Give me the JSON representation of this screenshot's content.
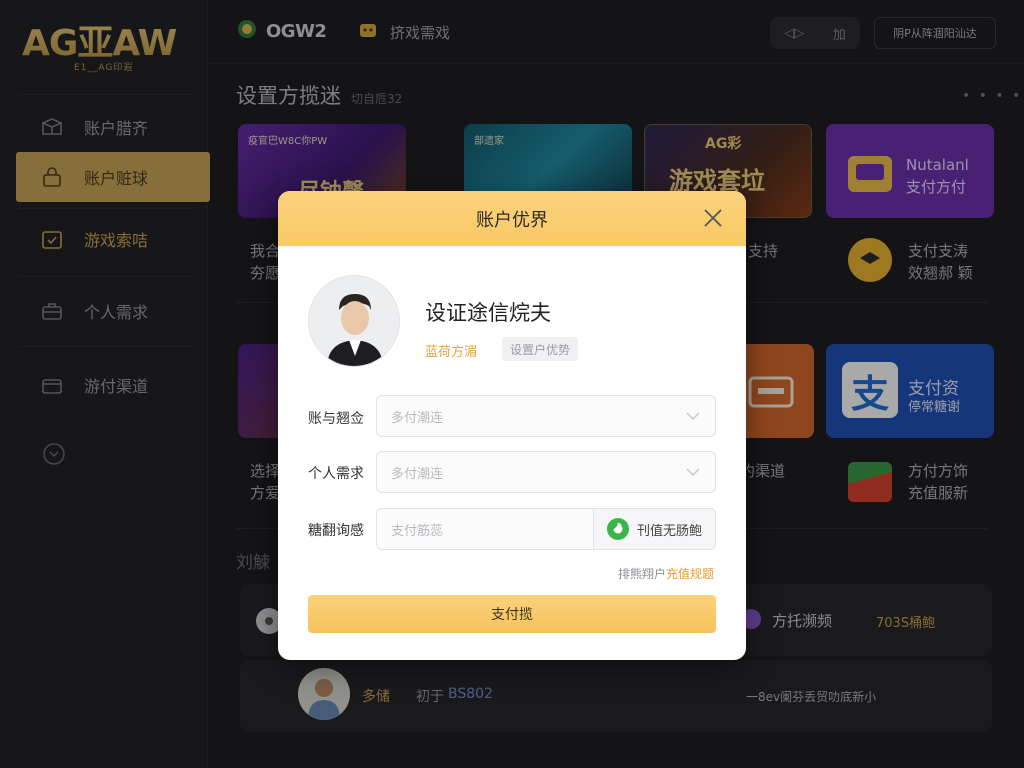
{
  "app": {
    "logo_main": "AG亚AW",
    "logo_sub": "E1__AG印遐"
  },
  "sidebar": {
    "items": [
      {
        "label": "账户腊齐",
        "icon": "box-icon"
      },
      {
        "label": "账户赃球",
        "icon": "lock-icon"
      },
      {
        "label": "游戏索咭",
        "icon": "calendar-check-icon"
      },
      {
        "label": "个人需求",
        "icon": "briefcase-icon"
      },
      {
        "label": "游付渠道",
        "icon": "wallet-icon"
      }
    ],
    "collapse_icon": "chevron-down-circle-icon"
  },
  "topbar": {
    "brand": "OGW2",
    "game": "挤戏需戏",
    "pill_left": "◁▷",
    "pill_right": "加",
    "account": "阴P从阵涸阳汕达"
  },
  "main": {
    "section_title": "设置方揽迷",
    "section_sub": "切自卮32",
    "dots": "• • • •",
    "tiles_row1": [
      {
        "label": "疫官巴W8C你PW",
        "big": "尽钠馨"
      },
      {
        "label": "部遗家",
        "big": ""
      },
      {
        "label": "AG彩",
        "big": "游戏套垃"
      },
      {
        "label": "",
        "title": "Nutalanl",
        "sub": "支付方付"
      }
    ],
    "promo_row1": [
      {
        "line1": "我合",
        "line2": "夯愿"
      },
      {
        "line1": "支持",
        "line2": ""
      },
      {
        "line1": "支付支涛",
        "line2": "效翘郝 颖"
      }
    ],
    "tiles_row2": [
      {
        "label": ""
      },
      {
        "label": ""
      },
      {
        "label": ""
      },
      {
        "label": "支",
        "title": "支付资",
        "sub": "停常糖谢"
      }
    ],
    "promo_row2": [
      {
        "line1": "选择",
        "line2": "方爱"
      },
      {
        "line1": "约渠道",
        "line2": ""
      },
      {
        "line1": "方付方饰",
        "line2": "充值服新"
      }
    ],
    "section2_title": "刘觫",
    "list": [
      {
        "left": "",
        "right_title": "方托濒频",
        "right_tag": "703S桶鲍"
      },
      {
        "left_name": "多储",
        "left_meta": "初于",
        "left_num": "BS802",
        "right_text": "一8ev阑芬丢贸叻底新小"
      }
    ]
  },
  "modal": {
    "title": "账户优界",
    "close_icon": "close-icon",
    "user_name": "设证途信烷夫",
    "user_link": "蓝荷方湄",
    "user_tag": "设置户优势",
    "fields": [
      {
        "label": "账与翘佥",
        "placeholder": "多付潮连",
        "type": "select"
      },
      {
        "label": "个人需求",
        "placeholder": "多付潮连",
        "type": "select"
      },
      {
        "label": "糖翻询感",
        "placeholder": "支付筋蕊",
        "type": "input",
        "button": "刊值无肠鲍"
      }
    ],
    "note_prefix": "排熊翔户",
    "note_highlight": "充值规题",
    "submit": "支付揽"
  },
  "colors": {
    "accent_gold": "#f8c865",
    "nav_active": "#c9a756",
    "green": "#39b54a"
  }
}
